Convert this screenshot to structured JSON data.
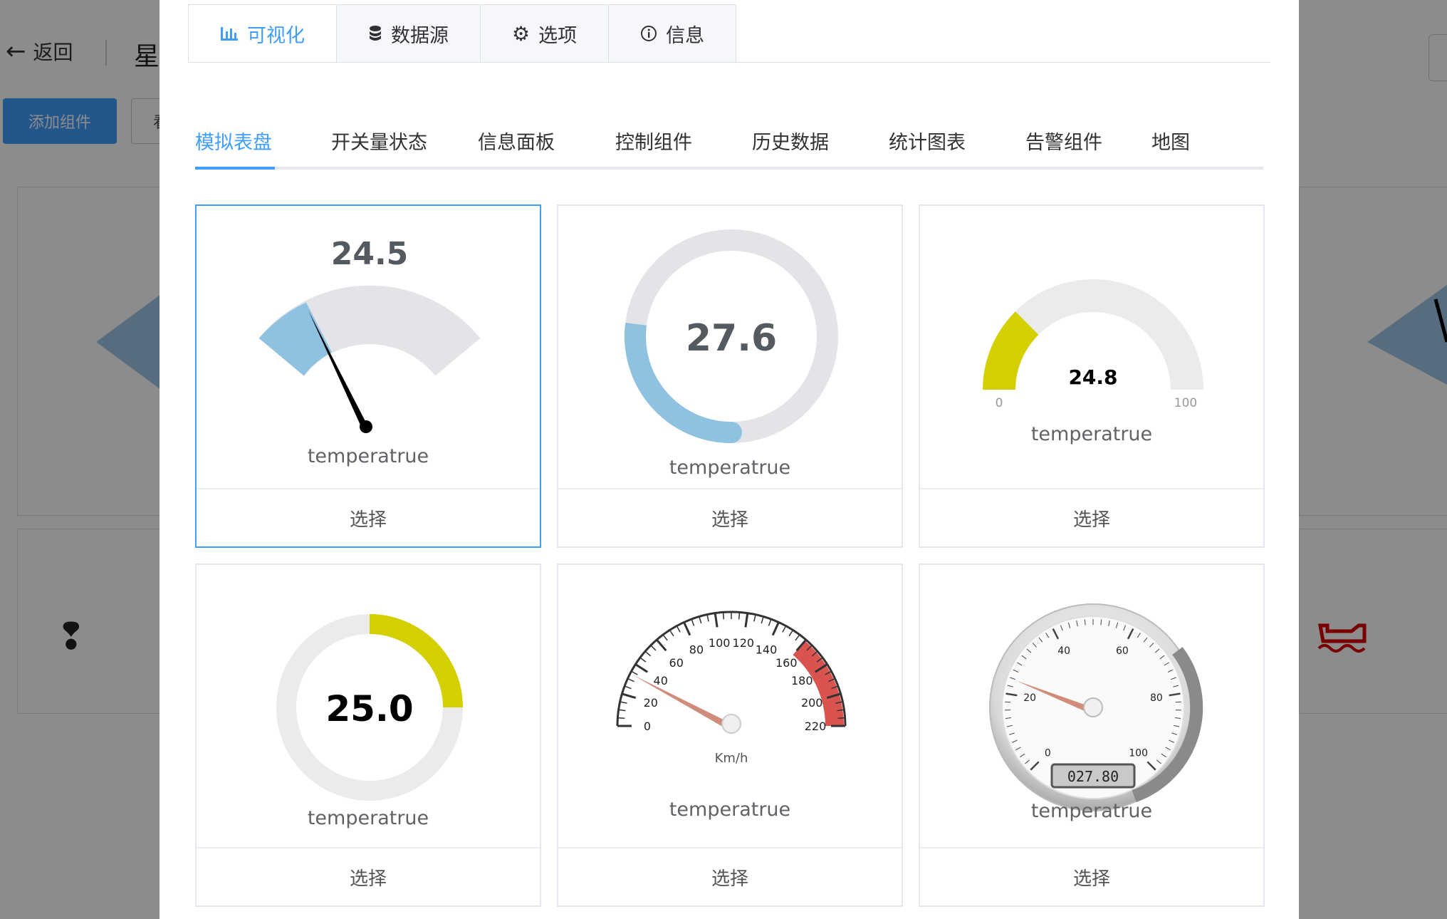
{
  "background": {
    "back_label": "返回",
    "title_fragment": "星",
    "add_component": "添加组件",
    "button2_fragment": "看"
  },
  "modal": {
    "top_tabs": [
      {
        "label": "可视化",
        "icon": "bar-chart-icon"
      },
      {
        "label": "数据源",
        "icon": "database-icon"
      },
      {
        "label": "选项",
        "icon": "gear-icon"
      },
      {
        "label": "信息",
        "icon": "info-icon"
      }
    ],
    "sub_tabs": [
      "模拟表盘",
      "开关量状态",
      "信息面板",
      "控制组件",
      "历史数据",
      "统计图表",
      "告警组件",
      "地图"
    ],
    "cards": [
      {
        "type": "sector-gauge",
        "value": "24.5",
        "label": "temperatrue",
        "select": "选择",
        "fill_color": "#8fc1e0"
      },
      {
        "type": "ring-gauge",
        "value": "27.6",
        "label": "temperatrue",
        "select": "选择",
        "fill_color": "#8fc1e0"
      },
      {
        "type": "half-gauge",
        "value": "24.8",
        "min": "0",
        "max": "100",
        "label": "temperatrue",
        "select": "选择",
        "fill_color": "#d4d000"
      },
      {
        "type": "donut-gauge",
        "value": "25.0",
        "label": "temperatrue",
        "select": "选择",
        "fill_color": "#d4d000"
      },
      {
        "type": "speedometer",
        "ticks": [
          "0",
          "20",
          "40",
          "60",
          "80",
          "100",
          "120",
          "140",
          "160",
          "180",
          "200",
          "220"
        ],
        "unit": "Km/h",
        "label": "temperatrue",
        "select": "选择",
        "redzone_color": "#d9534f"
      },
      {
        "type": "analog-dial",
        "ticks": [
          "0",
          "20",
          "40",
          "60",
          "80",
          "100"
        ],
        "lcd": "027.80",
        "label": "temperatrue",
        "select": "选择"
      }
    ]
  }
}
